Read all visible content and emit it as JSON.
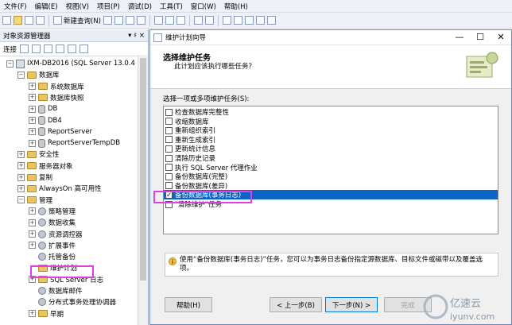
{
  "menu": [
    "文件(F)",
    "编辑(E)",
    "视图(V)",
    "项目(P)",
    "调试(D)",
    "工具(T)",
    "窗口(W)",
    "帮助(H)"
  ],
  "toolbar": {
    "new_query": "新建查询(N)"
  },
  "object_explorer": {
    "title": "对象资源管理器",
    "pin": "▾ ♯ ×",
    "connect": "连接",
    "tree": [
      {
        "label": "IXM-DB2016 (SQL Server 13.0.4",
        "icon": "server-icon",
        "exp": "−",
        "level": 0
      },
      {
        "label": "数据库",
        "icon": "folder-icon",
        "exp": "−",
        "level": 1
      },
      {
        "label": "系统数据库",
        "icon": "folder-icon",
        "exp": "+",
        "level": 2
      },
      {
        "label": "数据库快照",
        "icon": "folder-icon",
        "exp": "+",
        "level": 2
      },
      {
        "label": "DB",
        "icon": "database-icon",
        "exp": "+",
        "level": 2
      },
      {
        "label": "DB4",
        "icon": "database-icon",
        "exp": "+",
        "level": 2
      },
      {
        "label": "ReportServer",
        "icon": "database-icon",
        "exp": "+",
        "level": 2
      },
      {
        "label": "ReportServerTempDB",
        "icon": "database-icon",
        "exp": "+",
        "level": 2
      },
      {
        "label": "安全性",
        "icon": "folder-icon",
        "exp": "+",
        "level": 1
      },
      {
        "label": "服务器对象",
        "icon": "folder-icon",
        "exp": "+",
        "level": 1
      },
      {
        "label": "复制",
        "icon": "folder-icon",
        "exp": "+",
        "level": 1
      },
      {
        "label": "AlwaysOn 高可用性",
        "icon": "folder-icon",
        "exp": "+",
        "level": 1
      },
      {
        "label": "管理",
        "icon": "folder-icon",
        "exp": "−",
        "level": 1
      },
      {
        "label": "策略管理",
        "icon": "gear-icon",
        "exp": "+",
        "level": 2
      },
      {
        "label": "数据收集",
        "icon": "gear-icon",
        "exp": "+",
        "level": 2
      },
      {
        "label": "资源调控器",
        "icon": "gear-icon",
        "exp": "+",
        "level": 2
      },
      {
        "label": "扩展事件",
        "icon": "gear-icon",
        "exp": "+",
        "level": 2
      },
      {
        "label": "托管备份",
        "icon": "gear-icon",
        "exp": "",
        "level": 2
      },
      {
        "label": "维护计划",
        "icon": "folder-icon",
        "exp": "",
        "level": 2
      },
      {
        "label": "SQL Server 日志",
        "icon": "folder-icon",
        "exp": "+",
        "level": 2
      },
      {
        "label": "数据库邮件",
        "icon": "gear-icon",
        "exp": "",
        "level": 2
      },
      {
        "label": "分布式事务处理协调器",
        "icon": "gear-icon",
        "exp": "",
        "level": 2
      },
      {
        "label": "早期",
        "icon": "folder-icon",
        "exp": "+",
        "level": 2
      }
    ]
  },
  "wizard": {
    "window_title": "维护计划向导",
    "controls": [
      "—",
      "☐",
      "✕"
    ],
    "heading": "选择维护任务",
    "subheading": "此计划应该执行哪些任务？",
    "prompt": "选择一项或多项维护任务(S):",
    "tasks": [
      {
        "label": "检查数据库完整性",
        "checked": false,
        "selected": false
      },
      {
        "label": "收缩数据库",
        "checked": false,
        "selected": false
      },
      {
        "label": "重新组织索引",
        "checked": false,
        "selected": false
      },
      {
        "label": "重新生成索引",
        "checked": false,
        "selected": false
      },
      {
        "label": "更新统计信息",
        "checked": false,
        "selected": false
      },
      {
        "label": "清除历史记录",
        "checked": false,
        "selected": false
      },
      {
        "label": "执行 SQL Server 代理作业",
        "checked": false,
        "selected": false
      },
      {
        "label": "备份数据库(完整)",
        "checked": false,
        "selected": false
      },
      {
        "label": "备份数据库(差异)",
        "checked": false,
        "selected": false
      },
      {
        "label": "备份数据库(事务日志)",
        "checked": true,
        "selected": true
      },
      {
        "label": "\"清除维护\"任务",
        "checked": false,
        "selected": false
      }
    ],
    "info": "使用“备份数据库(事务日志)”任务，您可以为事务日志备份指定源数据库、目标文件或磁带以及覆盖选项。",
    "buttons": {
      "help": "帮助(H)",
      "back": "< 上一步(B)",
      "next": "下一步(N) >",
      "finish": "完成"
    }
  },
  "watermark": {
    "text": "亿速云",
    "sub": "iyunv.com"
  }
}
